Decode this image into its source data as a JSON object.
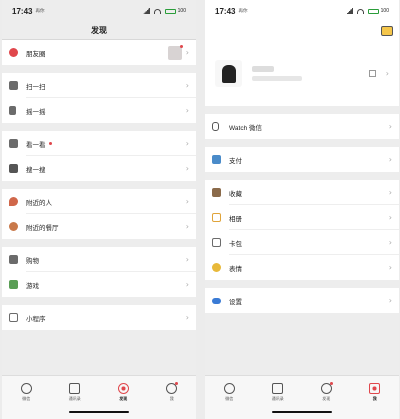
{
  "status": {
    "time": "17:43",
    "sub": "再你",
    "battery": "100"
  },
  "discover": {
    "title": "发现",
    "items": [
      {
        "label": "朋友圈",
        "icon": "moments-icon",
        "color": "#e0474c",
        "chevron": "›"
      },
      {
        "label": "扫一扫",
        "icon": "scan-icon",
        "color": "#6b6b6b",
        "chevron": "›"
      },
      {
        "label": "摇一摇",
        "icon": "shake-icon",
        "color": "#6b6b6b",
        "chevron": "›"
      },
      {
        "label": "看一看",
        "icon": "top-stories-icon",
        "color": "#6b6b6b",
        "chevron": "›"
      },
      {
        "label": "搜一搜",
        "icon": "search-icon",
        "color": "#555",
        "chevron": "›"
      },
      {
        "label": "附近的人",
        "icon": "people-nearby-icon",
        "color": "#d0674a",
        "chevron": "›"
      },
      {
        "label": "附近的餐厅",
        "icon": "restaurant-icon",
        "color": "#c9794a",
        "chevron": "›"
      },
      {
        "label": "购物",
        "icon": "shopping-bag-icon",
        "color": "#6b6b6b",
        "chevron": "›"
      },
      {
        "label": "游戏",
        "icon": "game-icon",
        "color": "#5a9e55",
        "chevron": "›"
      },
      {
        "label": "小程序",
        "icon": "mini-program-icon",
        "color": "#6b6b6b",
        "chevron": "›"
      }
    ]
  },
  "me": {
    "items": [
      {
        "label": "Watch 微信",
        "icon": "watch-icon",
        "color": "#555",
        "chevron": "›"
      },
      {
        "label": "支付",
        "icon": "payment-icon",
        "color": "#4a8bc9",
        "chevron": "›"
      },
      {
        "label": "收藏",
        "icon": "favorites-icon",
        "color": "#8a6a4a",
        "chevron": "›"
      },
      {
        "label": "相册",
        "icon": "album-icon",
        "color": "#e0a43a",
        "chevron": "›"
      },
      {
        "label": "卡包",
        "icon": "card-wallet-icon",
        "color": "#6b6b6b",
        "chevron": "›"
      },
      {
        "label": "表情",
        "icon": "sticker-icon",
        "color": "#e8b93a",
        "chevron": "›"
      },
      {
        "label": "设置",
        "icon": "settings-icon",
        "color": "#3a7bd5",
        "chevron": "›"
      }
    ]
  },
  "tabs": [
    {
      "label": "微信",
      "icon": "chat-icon"
    },
    {
      "label": "通讯录",
      "icon": "contacts-icon"
    },
    {
      "label": "发现",
      "icon": "discover-icon"
    },
    {
      "label": "我",
      "icon": "me-icon"
    }
  ]
}
